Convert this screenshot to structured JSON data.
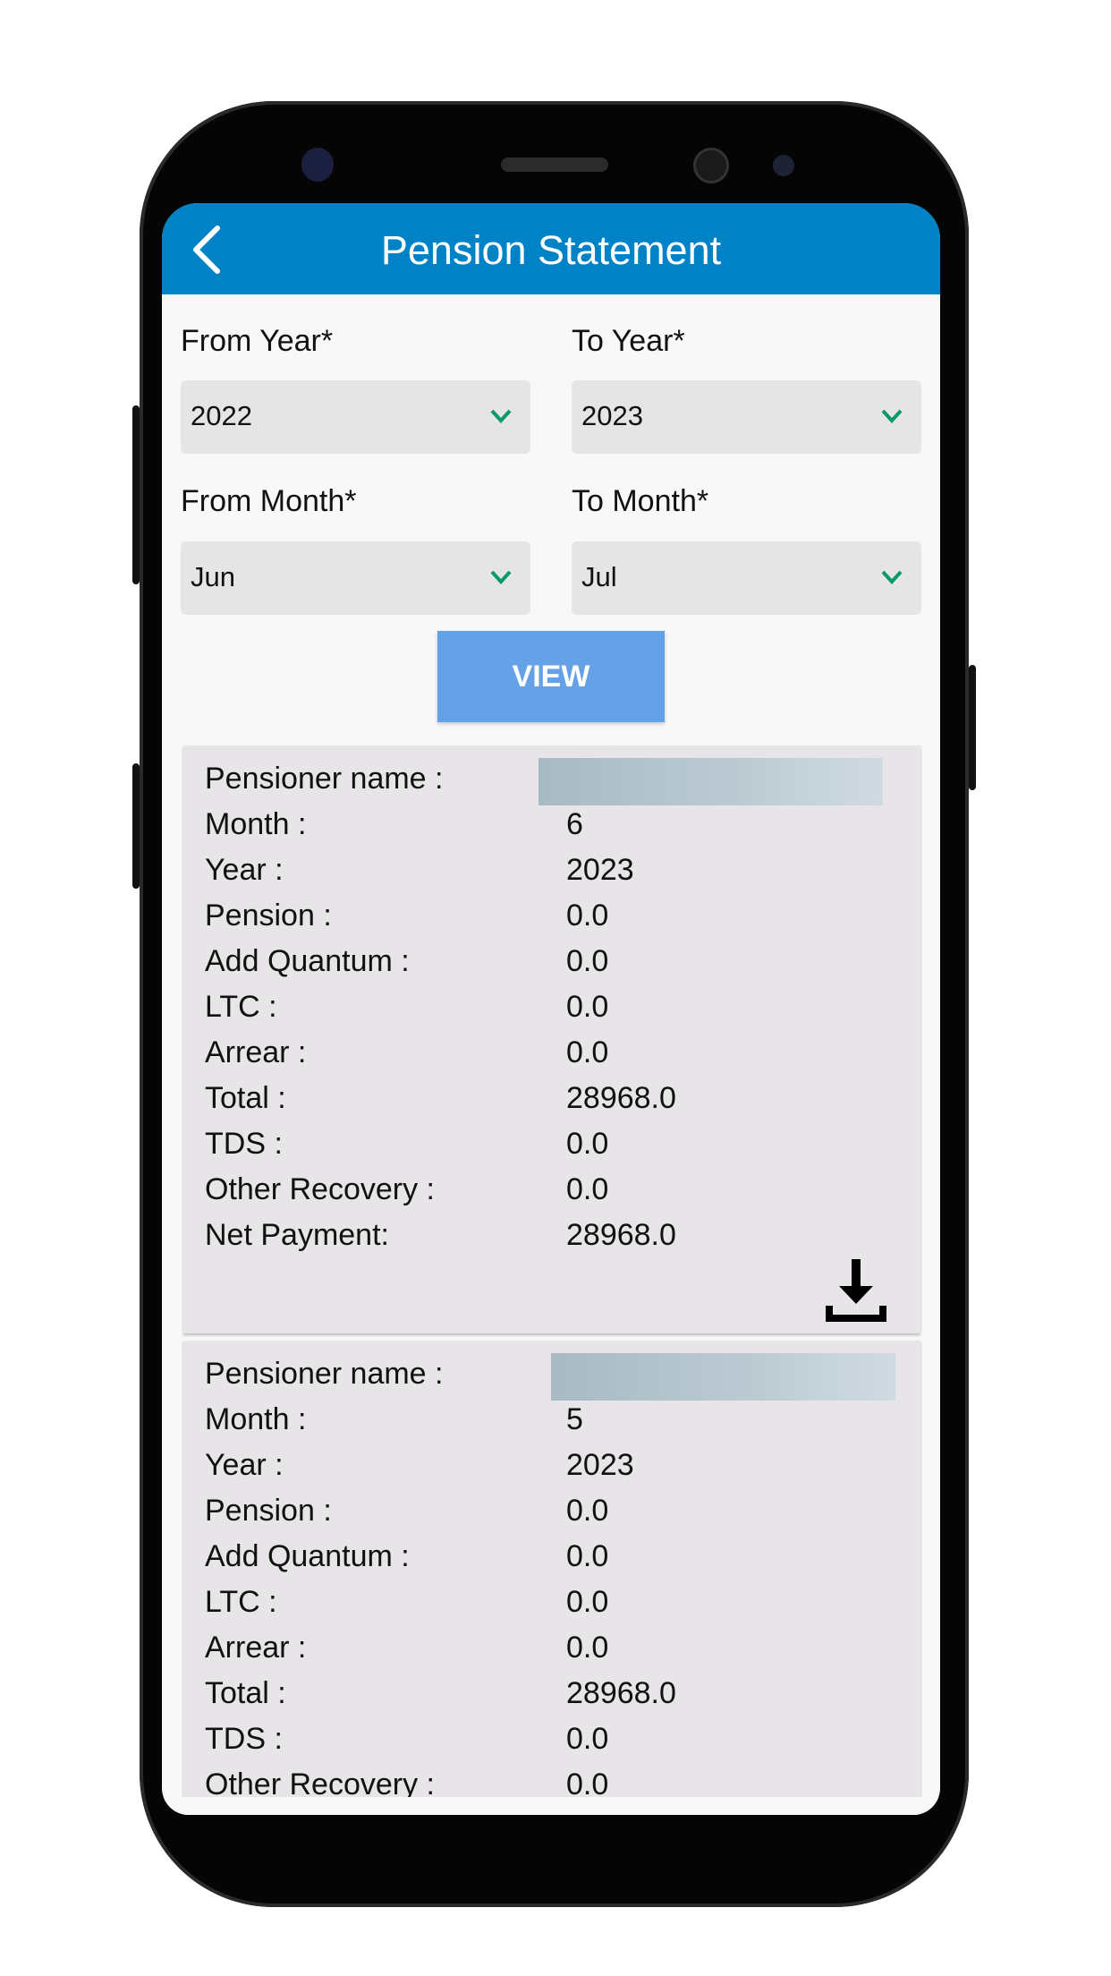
{
  "header": {
    "title": "Pension Statement",
    "back_icon": "chevron-left-icon"
  },
  "filters": {
    "from_year": {
      "label": "From Year*",
      "value": "2022"
    },
    "to_year": {
      "label": "To Year*",
      "value": "2023"
    },
    "from_month": {
      "label": "From Month*",
      "value": "Jun"
    },
    "to_month": {
      "label": "To Month*",
      "value": "Jul"
    },
    "dropdown_icon_color": "#0a9a6a"
  },
  "view_button": {
    "label": "VIEW"
  },
  "colors": {
    "header": "#0082c6",
    "button": "#64a1e6",
    "card": "#e7e5e7"
  },
  "statements": [
    {
      "rows": [
        {
          "label": "Pensioner name :",
          "value": ""
        },
        {
          "label": "Month :",
          "value": "6"
        },
        {
          "label": "Year :",
          "value": "2023"
        },
        {
          "label": "Pension :",
          "value": "0.0"
        },
        {
          "label": "Add Quantum :",
          "value": "0.0"
        },
        {
          "label": "LTC :",
          "value": "0.0"
        },
        {
          "label": "Arrear :",
          "value": "0.0"
        },
        {
          "label": "Total :",
          "value": "28968.0"
        },
        {
          "label": "TDS :",
          "value": "0.0"
        },
        {
          "label": "Other Recovery :",
          "value": "0.0"
        },
        {
          "label": "Net Payment:",
          "value": "28968.0"
        }
      ]
    },
    {
      "rows": [
        {
          "label": "Pensioner name :",
          "value": ""
        },
        {
          "label": "Month :",
          "value": "5"
        },
        {
          "label": "Year :",
          "value": "2023"
        },
        {
          "label": "Pension :",
          "value": "0.0"
        },
        {
          "label": "Add Quantum :",
          "value": "0.0"
        },
        {
          "label": "LTC :",
          "value": "0.0"
        },
        {
          "label": "Arrear :",
          "value": "0.0"
        },
        {
          "label": "Total :",
          "value": "28968.0"
        },
        {
          "label": "TDS :",
          "value": "0.0"
        },
        {
          "label": "Other Recovery :",
          "value": "0.0"
        }
      ]
    }
  ]
}
